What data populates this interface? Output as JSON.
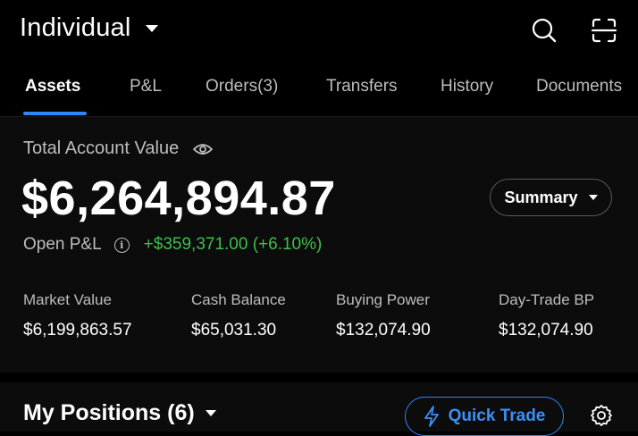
{
  "header": {
    "account_name": "Individual",
    "search_icon": "search-icon",
    "scan_icon": "scan-icon"
  },
  "tabs": [
    {
      "label": "Assets",
      "active": true
    },
    {
      "label": "P&L",
      "active": false
    },
    {
      "label": "Orders(3)",
      "active": false
    },
    {
      "label": "Transfers",
      "active": false
    },
    {
      "label": "History",
      "active": false
    },
    {
      "label": "Documents",
      "active": false
    }
  ],
  "account": {
    "total_label": "Total Account Value",
    "total_value": "$6,264,894.87",
    "summary_label": "Summary",
    "open_pnl_label": "Open P&L",
    "open_pnl_value": "+$359,371.00 (+6.10%)",
    "metrics": [
      {
        "label": "Market Value",
        "value": "$6,199,863.57"
      },
      {
        "label": "Cash Balance",
        "value": "$65,031.30"
      },
      {
        "label": "Buying Power",
        "value": "$132,074.90"
      },
      {
        "label": "Day-Trade BP",
        "value": "$132,074.90"
      }
    ]
  },
  "positions": {
    "title": "My Positions (6)",
    "quick_trade_label": "Quick Trade"
  },
  "colors": {
    "accent": "#2f86f6",
    "gain": "#3fbf4b",
    "background": "#000000",
    "card": "#0c0c0c"
  }
}
